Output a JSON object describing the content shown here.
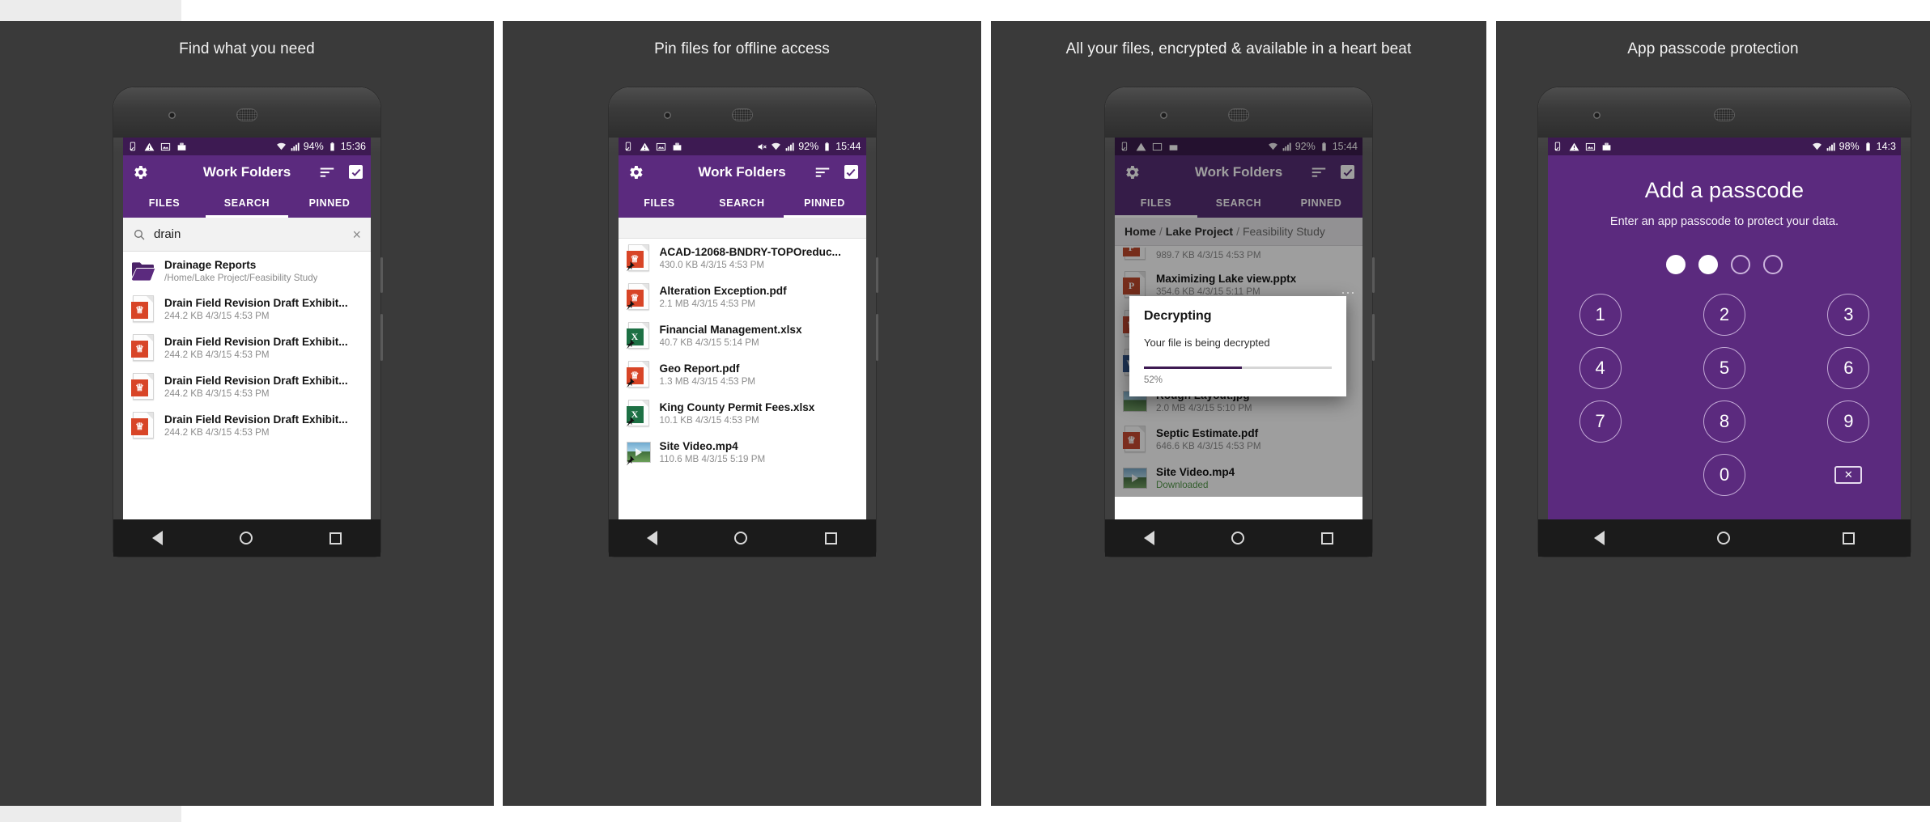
{
  "panels": [
    {
      "caption": "Find what you need",
      "status": {
        "battery": "94%",
        "time": "15:36"
      },
      "appbar": {
        "title": "Work Folders",
        "gear": "gear-icon",
        "sort": "sort-icon",
        "select": "checkbox-icon"
      },
      "tabs": [
        {
          "label": "FILES",
          "active": false
        },
        {
          "label": "SEARCH",
          "active": true
        },
        {
          "label": "PINNED",
          "active": false
        }
      ],
      "search": {
        "value": "drain",
        "clear": "×"
      },
      "rows": [
        {
          "title": "Drainage Reports",
          "sub": "/Home/Lake Project/Feasibility Study",
          "icon": "folder"
        },
        {
          "title": "Drain Field Revision Draft Exhibit...",
          "sub": "244.2 KB  4/3/15 4:53 PM",
          "icon": "pdf"
        },
        {
          "title": "Drain Field Revision Draft Exhibit...",
          "sub": "244.2 KB  4/3/15 4:53 PM",
          "icon": "pdf"
        },
        {
          "title": "Drain Field Revision Draft Exhibit...",
          "sub": "244.2 KB  4/3/15 4:53 PM",
          "icon": "pdf"
        },
        {
          "title": "Drain Field Revision Draft Exhibit...",
          "sub": "244.2 KB  4/3/15 4:53 PM",
          "icon": "pdf"
        }
      ]
    },
    {
      "caption": "Pin files for offline access",
      "status": {
        "battery": "92%",
        "time": "15:44"
      },
      "appbar": {
        "title": "Work Folders"
      },
      "tabs": [
        {
          "label": "FILES",
          "active": false
        },
        {
          "label": "SEARCH",
          "active": false
        },
        {
          "label": "PINNED",
          "active": true
        }
      ],
      "rows": [
        {
          "title": "ACAD-12068-BNDRY-TOPOreduc...",
          "sub": "430.0 KB  4/3/15 4:53 PM",
          "icon": "pdf",
          "pinned": true
        },
        {
          "title": "Alteration Exception.pdf",
          "sub": "2.1 MB  4/3/15 4:53 PM",
          "icon": "pdf",
          "pinned": true
        },
        {
          "title": "Financial Management.xlsx",
          "sub": "40.7 KB  4/3/15 5:14 PM",
          "icon": "xls",
          "pinned": true
        },
        {
          "title": "Geo Report.pdf",
          "sub": "1.3 MB  4/3/15 4:53 PM",
          "icon": "pdf",
          "pinned": true
        },
        {
          "title": "King County Permit Fees.xlsx",
          "sub": "10.1 KB  4/3/15 4:53 PM",
          "icon": "xls",
          "pinned": true
        },
        {
          "title": "Site Video.mp4",
          "sub": "110.6 MB  4/3/15 5:19 PM",
          "icon": "video",
          "pinned": true
        }
      ]
    },
    {
      "caption": "All your files, encrypted & available in a heart beat",
      "status": {
        "battery": "92%",
        "time": "15:44"
      },
      "appbar": {
        "title": "Work Folders"
      },
      "tabs": [
        {
          "label": "FILES",
          "active": true
        },
        {
          "label": "SEARCH",
          "active": false
        },
        {
          "label": "PINNED",
          "active": false
        }
      ],
      "breadcrumb": {
        "home": "Home",
        "mid": "Lake Project",
        "last": "Feasibility Study",
        "sep": "/"
      },
      "rows": [
        {
          "title": "",
          "sub": "989.7 KB  4/3/15 4:53 PM",
          "icon": "ppt"
        },
        {
          "title": "Maximizing Lake view.pptx",
          "sub": "354.6 KB  4/3/15 5:11 PM",
          "icon": "ppt"
        },
        {
          "title": "",
          "sub": "",
          "icon": "pdf"
        },
        {
          "title": "",
          "sub": "",
          "icon": "doc"
        },
        {
          "title": "Rough Layout.jpg",
          "sub": "2.0 MB  4/3/15 5:10 PM",
          "icon": "image"
        },
        {
          "title": "Septic Estimate.pdf",
          "sub": "646.6 KB  4/3/15 4:53 PM",
          "icon": "pdf"
        },
        {
          "title": "Site Video.mp4",
          "sub": "Downloaded",
          "icon": "video",
          "green": true
        }
      ],
      "overflow": "⋯",
      "dialog": {
        "title": "Decrypting",
        "message": "Your file is being decrypted",
        "progress_pct": 52,
        "progress_label": "52%"
      }
    },
    {
      "caption": "App passcode protection",
      "status": {
        "battery": "98%",
        "time": "14:3"
      },
      "passcode": {
        "title": "Add a passcode",
        "subtitle": "Enter an app passcode to protect your data.",
        "dots": [
          true,
          true,
          false,
          false
        ],
        "keys": [
          "1",
          "2",
          "3",
          "4",
          "5",
          "6",
          "7",
          "8",
          "9",
          "0"
        ],
        "delete": "delete-icon"
      }
    }
  ],
  "colors": {
    "statusbar": "#3d1a52",
    "appbar": "#5b2a7e",
    "accent": "#5b2a7e",
    "pdf": "#d84527",
    "xls": "#1d7044",
    "ppt": "#d04423",
    "doc": "#2b5797",
    "downloaded": "#4a9c3f"
  }
}
